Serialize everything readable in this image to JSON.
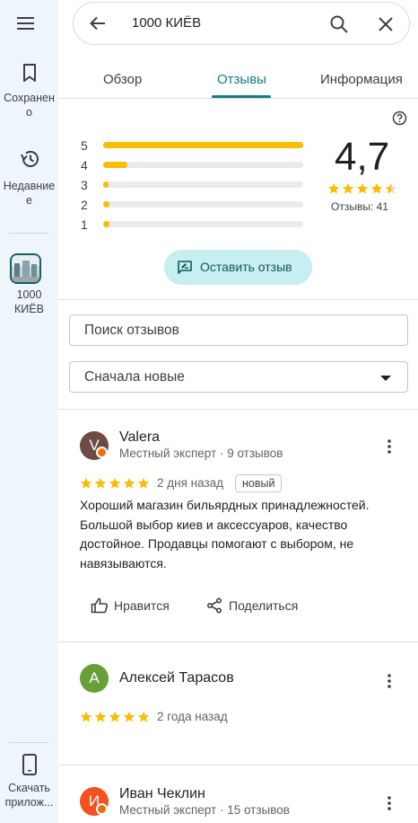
{
  "rail": {
    "saved_label_1": "Сохранен",
    "saved_label_2": "о",
    "recent_label_1": "Недавние",
    "recent_label_2": "е",
    "place_label_1": "1000",
    "place_label_2": "КИЁВ",
    "download_label_1": "Скачать",
    "download_label_2": "прилож..."
  },
  "search": {
    "query": "1000 КИЁВ"
  },
  "tabs": [
    {
      "label": "Обзор",
      "active": false
    },
    {
      "label": "Отзывы",
      "active": true
    },
    {
      "label": "Информация",
      "active": false
    }
  ],
  "summary": {
    "rating": "4,7",
    "stars": 4.7,
    "count_label": "Отзывы: 41",
    "distribution": [
      {
        "stars": "5",
        "fraction": 1.0
      },
      {
        "stars": "4",
        "fraction": 0.12
      },
      {
        "stars": "3",
        "fraction": 0.01
      },
      {
        "stars": "2",
        "fraction": 0.03
      },
      {
        "stars": "1",
        "fraction": 0.03
      }
    ]
  },
  "write_review_label": "Оставить отзыв",
  "search_reviews_placeholder": "Поиск отзывов",
  "sort": {
    "selected": "Сначала новые"
  },
  "reviews": [
    {
      "initial": "V",
      "avatar_color": "#6d4c41",
      "name": "Valera",
      "meta": "Местный эксперт · 9 отзывов",
      "stars": 5,
      "date": "2 дня назад",
      "badge": "новый",
      "text_lines": [
        "Хороший магазин бильярдных принадлежностей.",
        "Большой выбор киев и аксессуаров, качество",
        "достойное. Продавцы помогают с выбором, не",
        "навязываются."
      ],
      "like_label": "Нравится",
      "share_label": "Поделиться"
    },
    {
      "initial": "А",
      "avatar_color": "#689f38",
      "name": "Алексей Тарасов",
      "stars": 5,
      "date": "2 года назад"
    },
    {
      "initial": "И",
      "avatar_color": "#f4511e",
      "name": "Иван Чеклин",
      "meta": "Местный эксперт · 15 отзывов"
    }
  ],
  "colors": {
    "accent": "#137c82",
    "star": "#fbbc04",
    "badge": "#e8710a"
  }
}
